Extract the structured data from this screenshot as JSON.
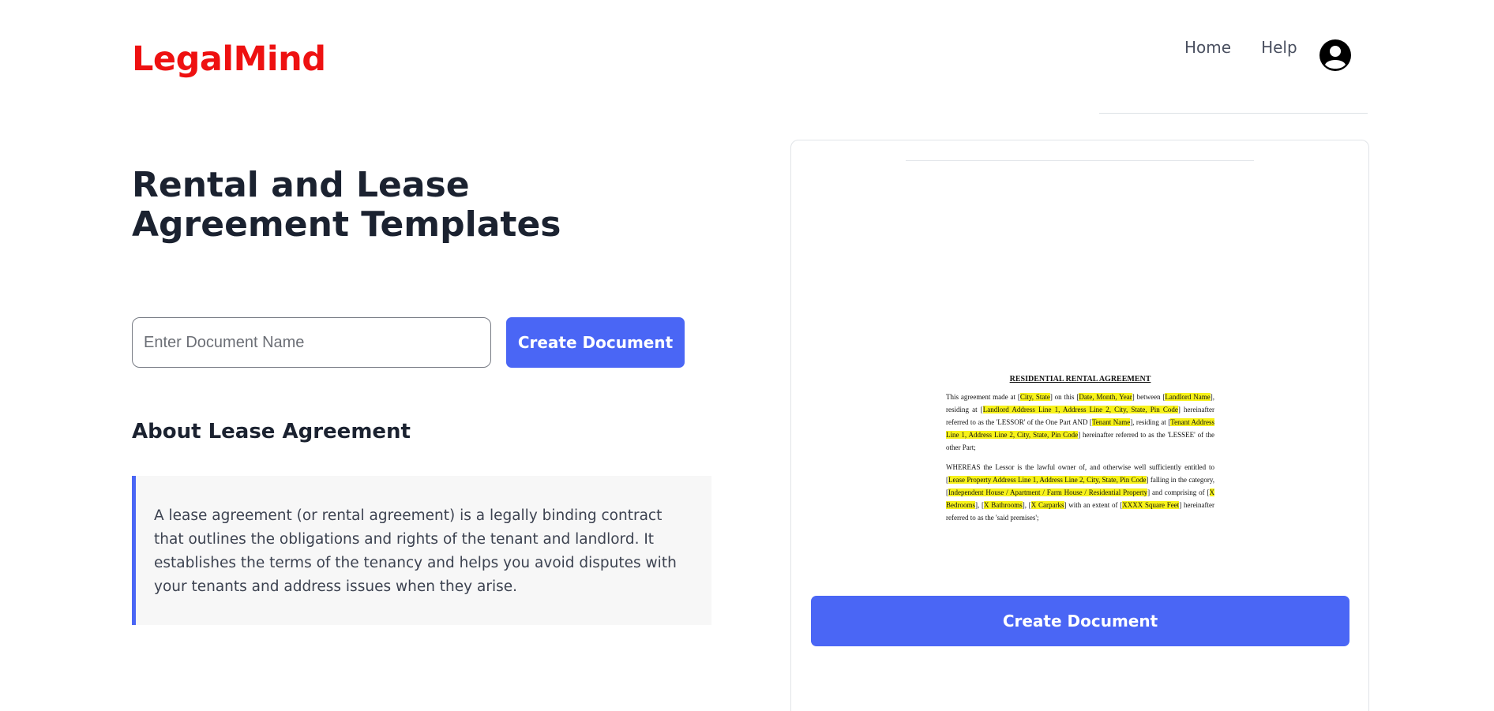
{
  "header": {
    "logo": "LegalMind",
    "nav": [
      {
        "label": "Home"
      },
      {
        "label": "Help"
      }
    ],
    "avatar_icon": "user-circle-icon"
  },
  "main": {
    "title": "Rental and Lease Agreement Templates",
    "doc_name_input": {
      "placeholder": "Enter Document Name",
      "value": ""
    },
    "create_button_label": "Create Document",
    "about": {
      "title": "About Lease Agreement",
      "text": "A lease agreement (or rental agreement) is a legally binding contract that outlines the obligations and rights of the tenant and landlord. It establishes the terms of the tenancy and helps you avoid disputes with your tenants and address issues when they arise."
    }
  },
  "preview": {
    "doc_title": "RESIDENTIAL RENTAL AGREEMENT",
    "p1": {
      "t1": "This agreement made at [",
      "h1": "City, State",
      "t2": "] on this [",
      "h2": "Date, Month, Year",
      "t3": "] between [",
      "h3": "Landlord Name",
      "t4": "], residing at [",
      "h4": "Landlord Address Line 1, Address Line 2, City, State, Pin Code",
      "t5": "] hereinafter referred to as the 'LESSOR' of the One Part AND [",
      "h5": "Tenant Name",
      "t6": "], residing at [",
      "h6": "Tenant Address Line 1, Address Line 2, City, State, Pin Code",
      "t7": "] hereinafter referred to as the 'LESSEE' of the other Part;"
    },
    "p2": {
      "t1": "WHEREAS the Lessor is the lawful owner of, and otherwise well sufficiently entitled to [",
      "h1": "Lease Property Address Line 1, Address Line 2, City, State, Pin Code",
      "t2": "] falling in the category, [",
      "h2": "Independent House / Apartment / Farm House / Residential Property",
      "t3": "] and comprising of [",
      "h3": "X Bedrooms",
      "t4": "], [",
      "h4": "X Bathrooms",
      "t5": "], [",
      "h5": "X Carparks",
      "t6": "] with an extent of [",
      "h6": "XXXX Square Feet",
      "t7": "] hereinafter referred to as the 'said premises';"
    },
    "highlight_color": "#f7f21a",
    "button_label": "Create Document"
  },
  "colors": {
    "brand": "#ee1111",
    "accent": "#4a66f5"
  }
}
